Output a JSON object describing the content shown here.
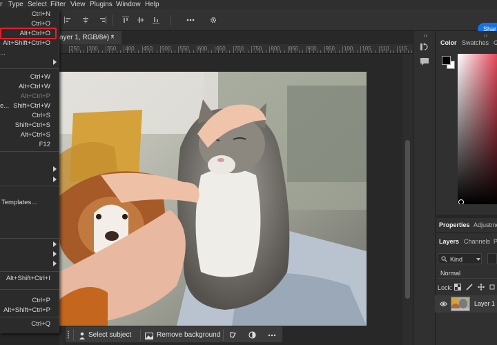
{
  "menubar": {
    "items": [
      "r",
      "Type",
      "Select",
      "Filter",
      "View",
      "Plugins",
      "Window",
      "Help"
    ]
  },
  "options": {
    "share_label": "Shar"
  },
  "document": {
    "tab_title": "ayer 1, RGB/8#) *",
    "tab_close": "×",
    "ruler_labels": [
      "250",
      "300",
      "350",
      "400",
      "450",
      "500",
      "550",
      "600",
      "650",
      "700",
      "750",
      "800",
      "850",
      "900",
      "950",
      "100",
      "105",
      "110",
      "115",
      "120"
    ]
  },
  "file_menu": {
    "items": [
      {
        "label": "",
        "shortcut": "Ctrl+N"
      },
      {
        "label": "",
        "shortcut": "Ctrl+O"
      },
      {
        "label": "",
        "shortcut": "Alt+Ctrl+O"
      },
      {
        "label": "",
        "shortcut": "Alt+Shift+Ctrl+O"
      },
      {
        "label": "...",
        "shortcut": ""
      },
      {
        "label": "",
        "shortcut": "Ctrl+W"
      },
      {
        "label": "",
        "shortcut": "Alt+Ctrl+W"
      },
      {
        "label": "",
        "shortcut": "Alt+Ctrl+P"
      },
      {
        "label": "e...",
        "shortcut": "Shift+Ctrl+W"
      },
      {
        "label": "",
        "shortcut": "Ctrl+S"
      },
      {
        "label": "",
        "shortcut": "Shift+Ctrl+S"
      },
      {
        "label": "",
        "shortcut": "Alt+Ctrl+S"
      },
      {
        "label": "",
        "shortcut": "F12"
      },
      {
        "label": "Templates...",
        "shortcut": ""
      },
      {
        "label": "",
        "shortcut": "Alt+Shift+Ctrl+I"
      },
      {
        "label": "",
        "shortcut": "Ctrl+P"
      },
      {
        "label": "",
        "shortcut": "Alt+Shift+Ctrl+P"
      },
      {
        "label": "",
        "shortcut": "Ctrl+Q"
      }
    ]
  },
  "context_bar": {
    "select_subject": "Select subject",
    "remove_background": "Remove background"
  },
  "right_panel": {
    "color_tab": "Color",
    "swatches_tab": "Swatches",
    "gradients_tab": "Gr",
    "properties_tab": "Properties",
    "adjustments_tab": "Adjustme",
    "layers_tab": "Layers",
    "channels_tab": "Channels",
    "paths_tab": "P",
    "kind_label": "Kind",
    "blend_mode": "Normal",
    "lock_label": "Lock:",
    "layer_name": "Layer 1"
  },
  "colors": {
    "accent": "#1473e6",
    "highlight": "#e3202a"
  }
}
